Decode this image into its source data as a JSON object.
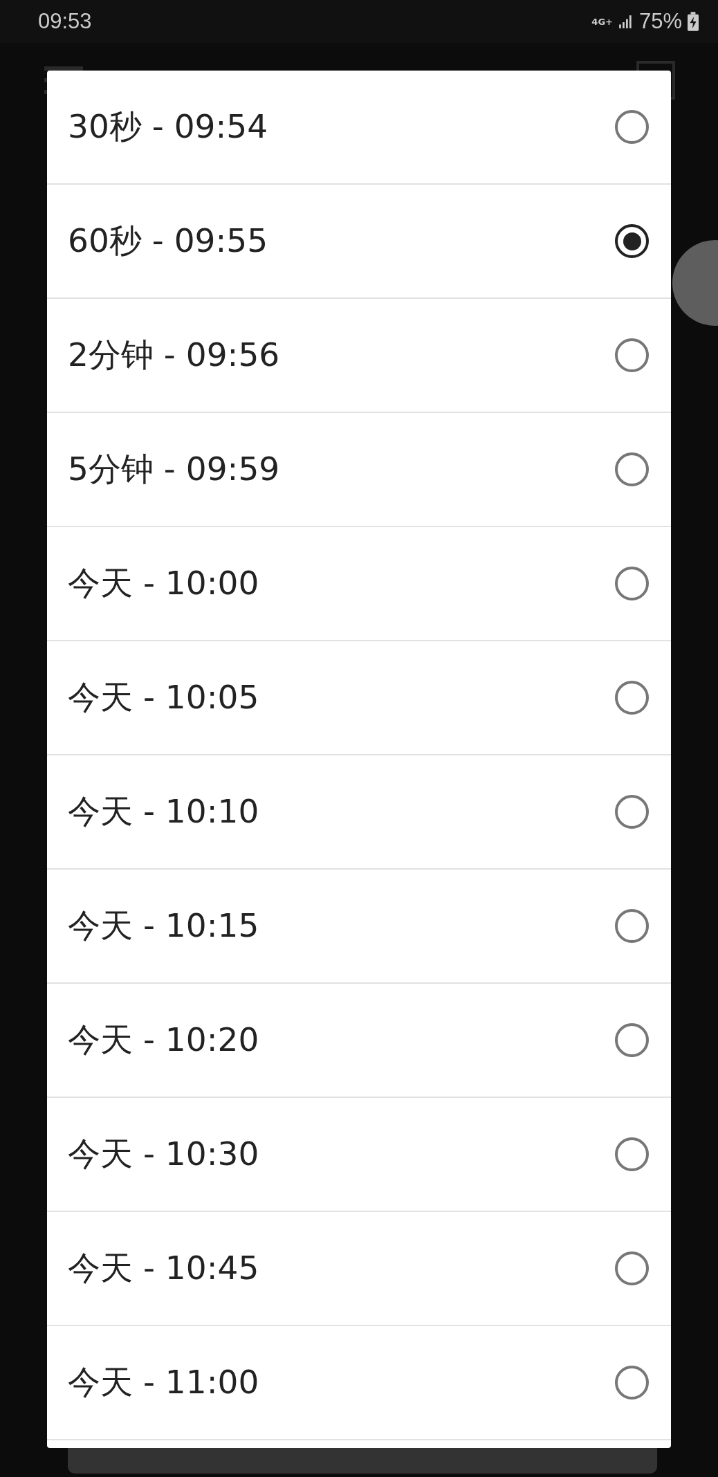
{
  "status_bar": {
    "time": "09:53",
    "network": "4G+",
    "battery": "75%"
  },
  "options": [
    {
      "label": "30秒 - 09:54",
      "selected": false
    },
    {
      "label": "60秒 - 09:55",
      "selected": true
    },
    {
      "label": "2分钟 - 09:56",
      "selected": false
    },
    {
      "label": "5分钟 - 09:59",
      "selected": false
    },
    {
      "label": "今天 - 10:00",
      "selected": false
    },
    {
      "label": "今天 - 10:05",
      "selected": false
    },
    {
      "label": "今天 - 10:10",
      "selected": false
    },
    {
      "label": "今天 - 10:15",
      "selected": false
    },
    {
      "label": "今天 - 10:20",
      "selected": false
    },
    {
      "label": "今天 - 10:30",
      "selected": false
    },
    {
      "label": "今天 - 10:45",
      "selected": false
    },
    {
      "label": "今天 - 11:00",
      "selected": false
    }
  ]
}
